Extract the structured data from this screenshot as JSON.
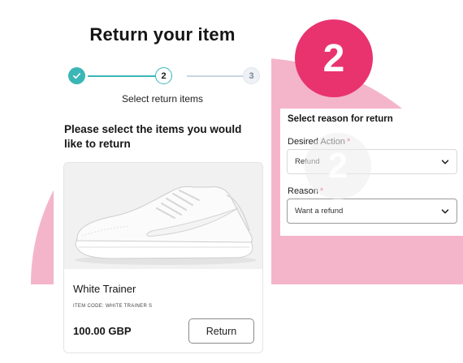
{
  "colors": {
    "accent_pink": "#e8336f",
    "blob_pink": "#f4b5cb",
    "teal": "#3bb6b6"
  },
  "badge": {
    "number": "2"
  },
  "left": {
    "title": "Return your item",
    "stepper": {
      "steps": [
        "",
        "2",
        "3"
      ],
      "current_index": 1,
      "caption": "Select return items"
    },
    "instructions": "Please select the items you would like to return",
    "product": {
      "image_icon": "white-trainer-image",
      "name": "White Trainer",
      "item_code": "ITEM CODE: WHITE TRAINER S",
      "price": "100.00 GBP",
      "return_label": "Return"
    }
  },
  "right": {
    "title": "Select reason for return",
    "desired_action": {
      "label": "Desired Action",
      "value": "Refund"
    },
    "reason": {
      "label": "Reason",
      "value": "Want a refund"
    },
    "watermark": "2",
    "required_mark": "*"
  }
}
